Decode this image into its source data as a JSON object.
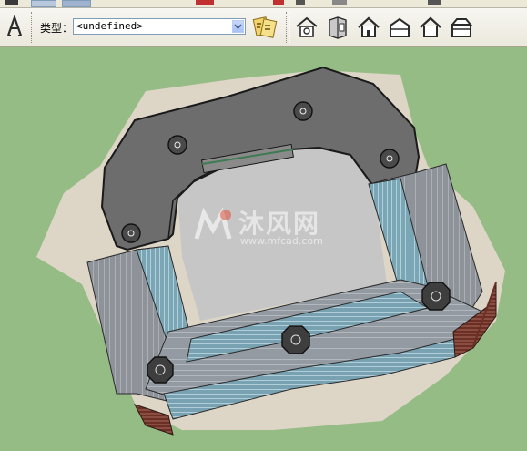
{
  "toolbar": {
    "type_label": "类型：",
    "type_value": "<undefined>"
  },
  "watermark": {
    "text": "沐风网",
    "url": "www.mfcad.com"
  },
  "icons": [
    "text-tool-icon",
    "component-attributes-icon",
    "warehouse-icon",
    "share-component-icon",
    "house-icon",
    "house-outline-icon",
    "house-side-icon",
    "house-front-icon",
    "house-gable-icon"
  ]
}
